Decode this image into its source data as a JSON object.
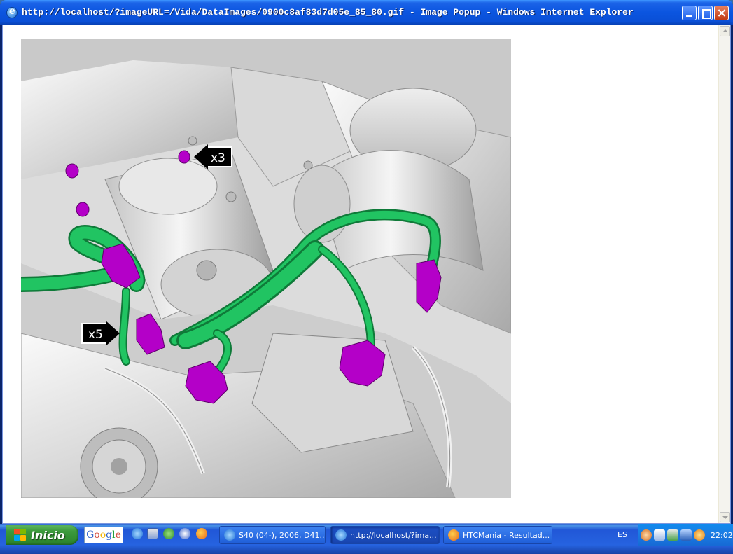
{
  "window": {
    "title": "http://localhost/?imageURL=/Vida/DataImages/0900c8af83d7d05e_85_80.gif - Image Popup - Windows Internet Explorer"
  },
  "figure": {
    "callouts": [
      {
        "label": "x3"
      },
      {
        "label": "x5"
      }
    ]
  },
  "taskbar": {
    "start_label": "Inicio",
    "google_text": [
      "G",
      "o",
      "o",
      "g",
      "l",
      "e"
    ],
    "tasks": [
      {
        "label": "S40 (04-), 2006, D41..."
      },
      {
        "label": "http://localhost/?ima..."
      },
      {
        "label": "HTCMania - Resultad..."
      }
    ],
    "language": "ES",
    "clock": "22:02"
  },
  "colors": {
    "title_blue": "#0b55e0",
    "harness_green": "#1fbf5a",
    "connector_magenta": "#b400c8",
    "start_green": "#3c9a3c",
    "taskbar_blue": "#2663e0"
  }
}
